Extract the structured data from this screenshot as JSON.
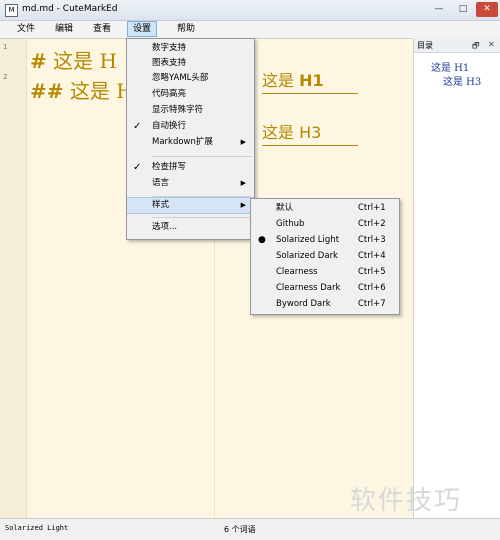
{
  "window": {
    "title": "md.md - CuteMarkEd",
    "min": "—",
    "max": "□",
    "close": "✕"
  },
  "menubar": [
    "文件",
    "编辑",
    "查看",
    "设置",
    "帮助"
  ],
  "settings_menu": {
    "items": [
      {
        "label": "数字支持",
        "checked": false,
        "submenu": false
      },
      {
        "label": "图表支持",
        "checked": false,
        "submenu": false
      },
      {
        "label": "忽略YAML头部",
        "checked": false,
        "submenu": false
      },
      {
        "label": "代码高亮",
        "checked": false,
        "submenu": false
      },
      {
        "label": "显示特殊字符",
        "checked": false,
        "submenu": false
      },
      {
        "label": "自动换行",
        "checked": true,
        "submenu": false
      },
      {
        "label": "Markdown扩展",
        "checked": false,
        "submenu": true
      },
      {
        "label": "检查拼写",
        "checked": true,
        "submenu": false
      },
      {
        "label": "语言",
        "checked": false,
        "submenu": true
      },
      {
        "label": "样式",
        "checked": false,
        "submenu": true,
        "highlighted": true
      },
      {
        "label": "选项...",
        "checked": false,
        "submenu": false
      }
    ],
    "check_glyph": "✓",
    "arrow_glyph": "▶"
  },
  "style_submenu": {
    "items": [
      {
        "label": "默认",
        "shortcut": "Ctrl+1",
        "selected": false
      },
      {
        "label": "Github",
        "shortcut": "Ctrl+2",
        "selected": false
      },
      {
        "label": "Solarized Light",
        "shortcut": "Ctrl+3",
        "selected": true
      },
      {
        "label": "Solarized Dark",
        "shortcut": "Ctrl+4",
        "selected": false
      },
      {
        "label": "Clearness",
        "shortcut": "Ctrl+5",
        "selected": false
      },
      {
        "label": "Clearness Dark",
        "shortcut": "Ctrl+6",
        "selected": false
      },
      {
        "label": "Byword Dark",
        "shortcut": "Ctrl+7",
        "selected": false
      }
    ],
    "dot_glyph": "●"
  },
  "editor": {
    "lines": [
      {
        "number": "1",
        "hash": "#",
        "text": "这是 H"
      },
      {
        "number": "2",
        "hash": "##",
        "text": "这是 H"
      }
    ]
  },
  "preview": {
    "h1_text": "这是 ",
    "h1_tag": "H1",
    "h3_text": "这是 ",
    "h3_tag": "H3"
  },
  "toc": {
    "title": "目录",
    "float_btn": "🗗",
    "close_btn": "✕",
    "entries": [
      "这是 H1",
      "这是 H3"
    ]
  },
  "status": {
    "style_name": "Solarized Light",
    "word_count": "6 个词语"
  },
  "watermark": "软件技巧",
  "colors": {
    "accent": "#b58900",
    "background": "#fdf6e3",
    "toc_link": "#1a3a9a"
  }
}
